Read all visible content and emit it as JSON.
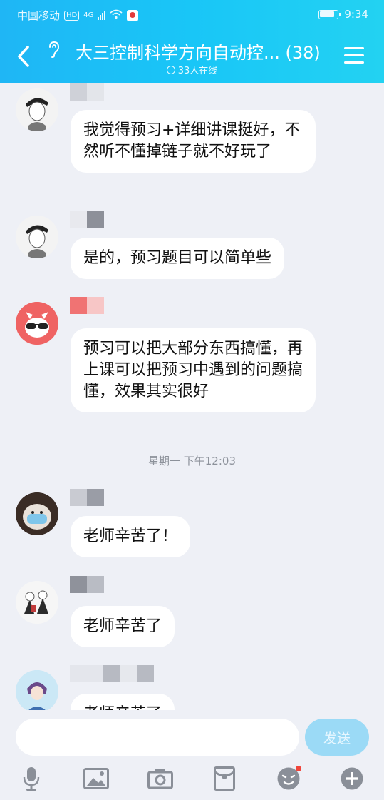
{
  "status_bar": {
    "carrier": "中国移动",
    "hd_badge": "HD",
    "network": "4G",
    "time": "9:34"
  },
  "header": {
    "title": "大三控制科学方向自动控... (38)",
    "online_status": "33人在线"
  },
  "messages": [
    {
      "sender_blurred": true,
      "avatar": "avatar-anime-boy-cap",
      "text": "我觉得预习+详细讲课挺好，不然听不懂掉链子就不好玩了"
    },
    {
      "sender_blurred": true,
      "avatar": "avatar-anime-boy-cap",
      "text": "是的，预习题目可以简单些"
    },
    {
      "sender_blurred": true,
      "avatar": "avatar-red-cat-sunglasses",
      "text": "预习可以把大部分东西搞懂，再上课可以把预习中遇到的问题搞懂，效果其实很好"
    },
    {
      "sender_blurred": true,
      "avatar": "avatar-masked-figure",
      "text": "老师辛苦了！"
    },
    {
      "sender_blurred": true,
      "avatar": "avatar-anime-characters",
      "text": "老师辛苦了"
    },
    {
      "sender_blurred": true,
      "avatar": "avatar-anime-girl",
      "text": "老师辛苦了"
    }
  ],
  "time_divider": "星期一 下午12:03",
  "input": {
    "value": "",
    "placeholder": ""
  },
  "send_label": "发送",
  "toolbar_icons": [
    "microphone-icon",
    "image-icon",
    "camera-icon",
    "red-packet-icon",
    "emoji-icon",
    "plus-icon"
  ],
  "colors": {
    "header_gradient_start": "#1fb6f5",
    "header_gradient_end": "#23d2f2",
    "background": "#eef0f6",
    "bubble": "#ffffff",
    "send_button": "#9bdaf6",
    "icon_gray": "#8a8f98"
  }
}
